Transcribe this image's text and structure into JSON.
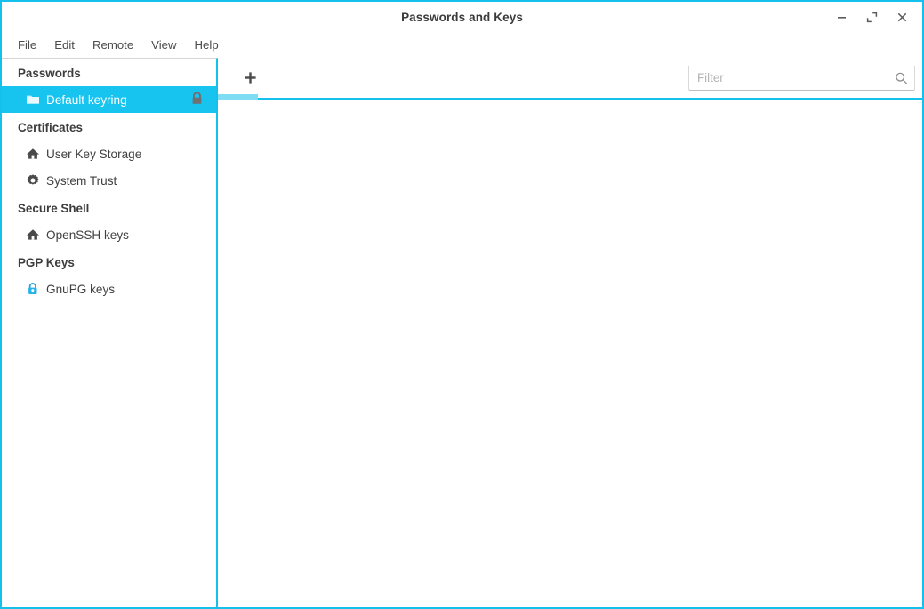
{
  "window": {
    "title": "Passwords and Keys",
    "accent_color": "#16c0ec",
    "selection_color": "#17c3ef",
    "controls": [
      {
        "name": "minimize-button",
        "glyph": "minimize"
      },
      {
        "name": "maximize-button",
        "glyph": "maximize"
      },
      {
        "name": "close-button",
        "glyph": "close"
      }
    ]
  },
  "menubar": {
    "items": [
      {
        "label": "File"
      },
      {
        "label": "Edit"
      },
      {
        "label": "Remote"
      },
      {
        "label": "View"
      },
      {
        "label": "Help"
      }
    ]
  },
  "sidebar": {
    "groups": [
      {
        "header": "Passwords",
        "items": [
          {
            "label": "Default keyring",
            "icon": "folder-icon",
            "trailing_icon": "lock-icon",
            "selected": true
          }
        ]
      },
      {
        "header": "Certificates",
        "items": [
          {
            "label": "User Key Storage",
            "icon": "home-icon",
            "selected": false
          },
          {
            "label": "System Trust",
            "icon": "gear-icon",
            "selected": false
          }
        ]
      },
      {
        "header": "Secure Shell",
        "items": [
          {
            "label": "OpenSSH keys",
            "icon": "home-icon",
            "selected": false
          }
        ]
      },
      {
        "header": "PGP Keys",
        "items": [
          {
            "label": "GnuPG keys",
            "icon": "gnupg-lock-icon",
            "selected": false
          }
        ]
      }
    ]
  },
  "main": {
    "toolbar": {
      "add_button_label": "+",
      "add_button_icon": "plus-icon",
      "filter": {
        "value": "",
        "placeholder": "Filter",
        "icon": "search-icon"
      }
    },
    "content": {
      "items": []
    }
  }
}
